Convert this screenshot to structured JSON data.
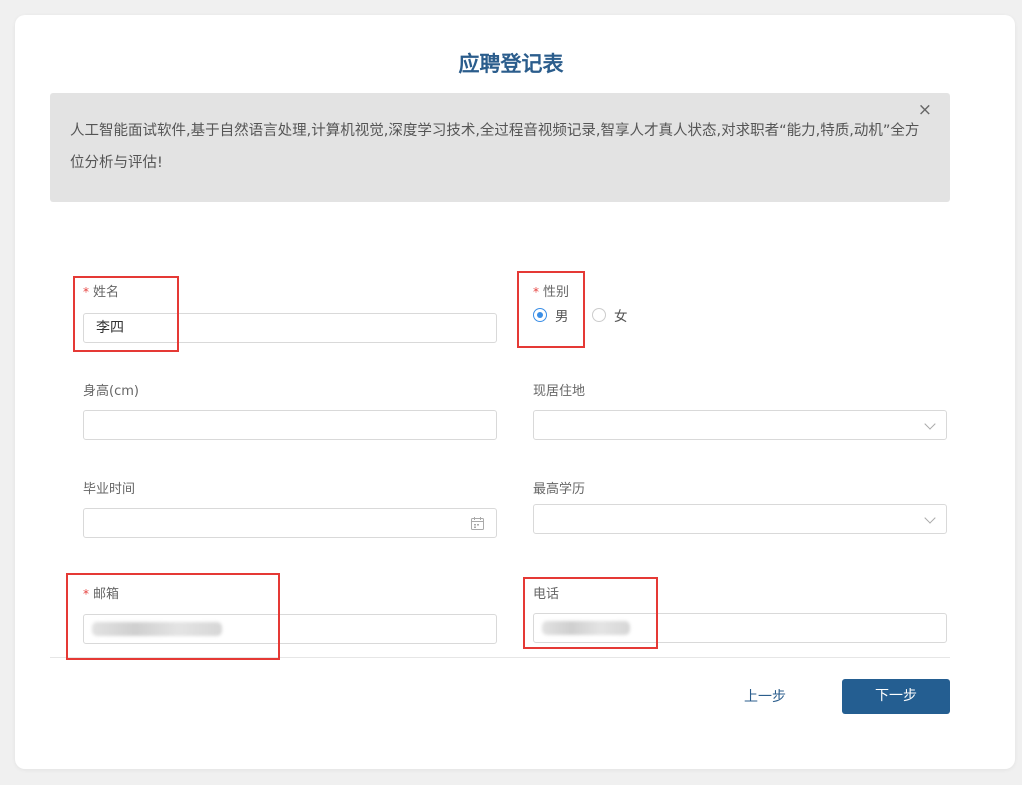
{
  "form": {
    "title": "应聘登记表",
    "banner": {
      "text": "人工智能面试软件,基于自然语言处理,计算机视觉,深度学习技术,全过程音视频记录,智享人才真人状态,对求职者“能力,特质,动机”全方位分析与评估!",
      "close_icon": "×"
    },
    "required_mark": "*",
    "fields": {
      "name": {
        "label": "姓名",
        "value": "李四",
        "required": true
      },
      "gender": {
        "label": "性别",
        "required": true,
        "options": [
          {
            "label": "男",
            "selected": true
          },
          {
            "label": "女",
            "selected": false
          }
        ]
      },
      "height": {
        "label": "身高(cm)",
        "value": ""
      },
      "residence": {
        "label": "现居住地",
        "value": ""
      },
      "graduation": {
        "label": "毕业时间",
        "value": ""
      },
      "education": {
        "label": "最高学历",
        "value": ""
      },
      "email": {
        "label": "邮箱",
        "value": "",
        "required": true,
        "redacted": true
      },
      "phone": {
        "label": "电话",
        "value": "",
        "redacted": true
      }
    },
    "buttons": {
      "prev": "上一步",
      "next": "下一步"
    }
  },
  "icons": {
    "close": "close-icon",
    "calendar": "calendar-icon",
    "dropdown": "chevron-down-icon"
  },
  "colors": {
    "title": "#2b5d8c",
    "primary_button": "#245e91",
    "required": "#e64340",
    "radio_selected": "#3a8ee6",
    "highlight_box": "#e53935"
  }
}
